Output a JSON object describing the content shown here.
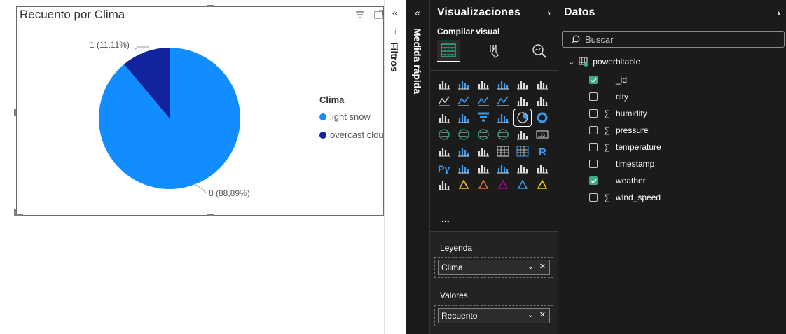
{
  "canvas": {
    "visual": {
      "title": "Recuento por Clima",
      "legend_title": "Clima",
      "legend": [
        {
          "label": "light snow",
          "color": "#118DFF"
        },
        {
          "label": "overcast clou",
          "color": "#12239E"
        }
      ],
      "data_labels": [
        "1 (11,11%)",
        "8 (88,89%)"
      ]
    }
  },
  "chart_data": {
    "type": "pie",
    "title": "Recuento por Clima",
    "legend_title": "Clima",
    "categories": [
      "light snow",
      "overcast clouds"
    ],
    "values": [
      8,
      1
    ],
    "percentages": [
      "88,89%",
      "11,11%"
    ],
    "colors": [
      "#118DFF",
      "#12239E"
    ],
    "legend_position": "right"
  },
  "filters_strip": {
    "label": "Filtros"
  },
  "quick_measure_strip": {
    "label": "Medida rápida"
  },
  "visualizations": {
    "title": "Visualizaciones",
    "build_label": "Compilar visual",
    "more": "...",
    "wells": [
      {
        "label": "Leyenda",
        "field": "Clima"
      },
      {
        "label": "Valores",
        "field": "Recuento"
      }
    ]
  },
  "data_pane": {
    "title": "Datos",
    "search_placeholder": "Buscar",
    "table": "powerbitable",
    "fields": [
      {
        "name": "_id",
        "checked": true,
        "sigma": false
      },
      {
        "name": "city",
        "checked": false,
        "sigma": false
      },
      {
        "name": "humidity",
        "checked": false,
        "sigma": true
      },
      {
        "name": "pressure",
        "checked": false,
        "sigma": true
      },
      {
        "name": "temperature",
        "checked": false,
        "sigma": true
      },
      {
        "name": "timestamp",
        "checked": false,
        "sigma": false
      },
      {
        "name": "weather",
        "checked": true,
        "sigma": false
      },
      {
        "name": "wind_speed",
        "checked": false,
        "sigma": true
      }
    ]
  },
  "colors": {
    "accent": "#118DFF",
    "dark_series": "#12239E",
    "pane_bg": "#1b1b1b",
    "check": "#3fa98c"
  }
}
